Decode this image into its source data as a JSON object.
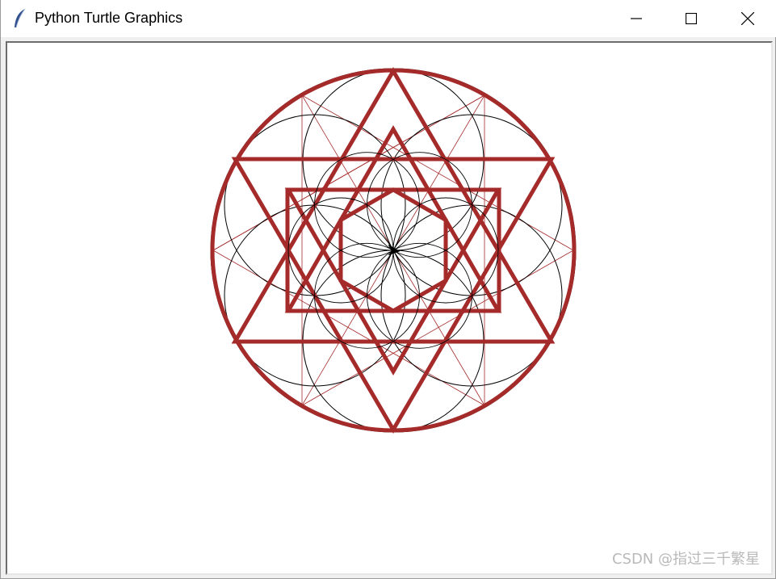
{
  "window": {
    "title": "Python Turtle Graphics",
    "icon": "feather-icon",
    "controls": [
      "minimize-icon",
      "maximize-icon",
      "close-icon"
    ]
  },
  "canvas": {
    "background": "#ffffff",
    "pen_color_primary": "#a52a2a",
    "pen_color_secondary": "#000000",
    "cursor": "turtle-arrow-icon"
  },
  "watermark": "CSDN @指过三千繁星"
}
